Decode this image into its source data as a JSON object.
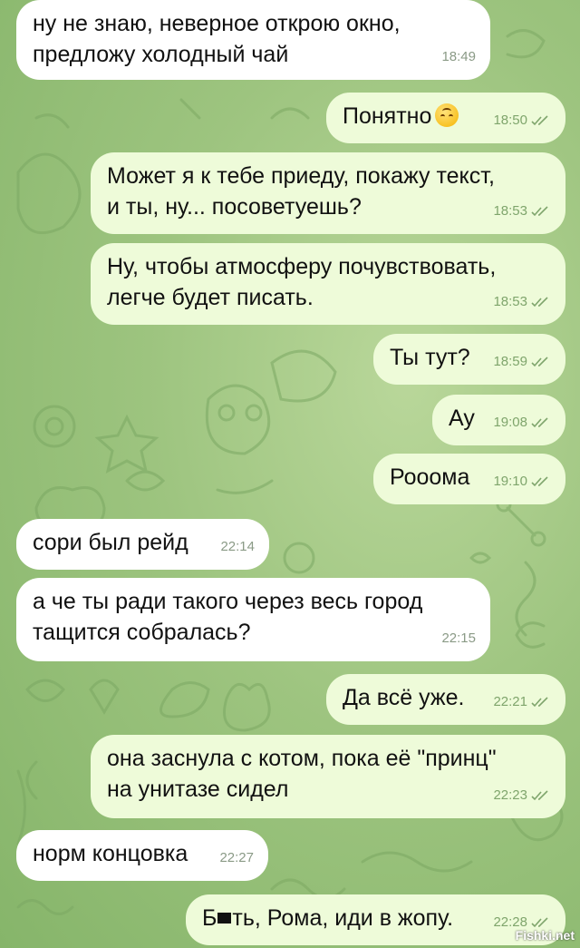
{
  "messages": [
    {
      "lines": [
        "ну не знаю, неверное открою окно,",
        "предложу холодный чай"
      ],
      "time": "18:49"
    },
    {
      "lines": [
        "Понятно"
      ],
      "time": "18:50"
    },
    {
      "lines": [
        "Может я к тебе приеду, покажу текст,",
        "и ты, ну... посоветуешь?"
      ],
      "time": "18:53"
    },
    {
      "lines": [
        "Ну, чтобы атмосферу почувствовать,",
        "легче будет писать."
      ],
      "time": "18:53"
    },
    {
      "lines": [
        "Ты тут?"
      ],
      "time": "18:59"
    },
    {
      "lines": [
        "Ау"
      ],
      "time": "19:08"
    },
    {
      "lines": [
        "Рооома"
      ],
      "time": "19:10"
    },
    {
      "lines": [
        "сори был рейд"
      ],
      "time": "22:14"
    },
    {
      "lines": [
        "а че ты ради такого через весь город",
        "тащится собралась?"
      ],
      "time": "22:15"
    },
    {
      "lines": [
        "Да всё уже."
      ],
      "time": "22:21"
    },
    {
      "lines": [
        "она заснула с котом, пока её \"принц\"",
        "на унитазе сидел"
      ],
      "time": "22:23"
    },
    {
      "lines": [
        "норм концовка"
      ],
      "time": "22:27"
    },
    {
      "lines": [
        "Б",
        "ть, Рома, иди в жопу."
      ],
      "time": "22:28"
    }
  ],
  "watermark": "Fishki.net",
  "colors": {
    "incoming": "#ffffff",
    "outgoing": "#eefbd9",
    "wallpaper": "#9dc47f"
  }
}
